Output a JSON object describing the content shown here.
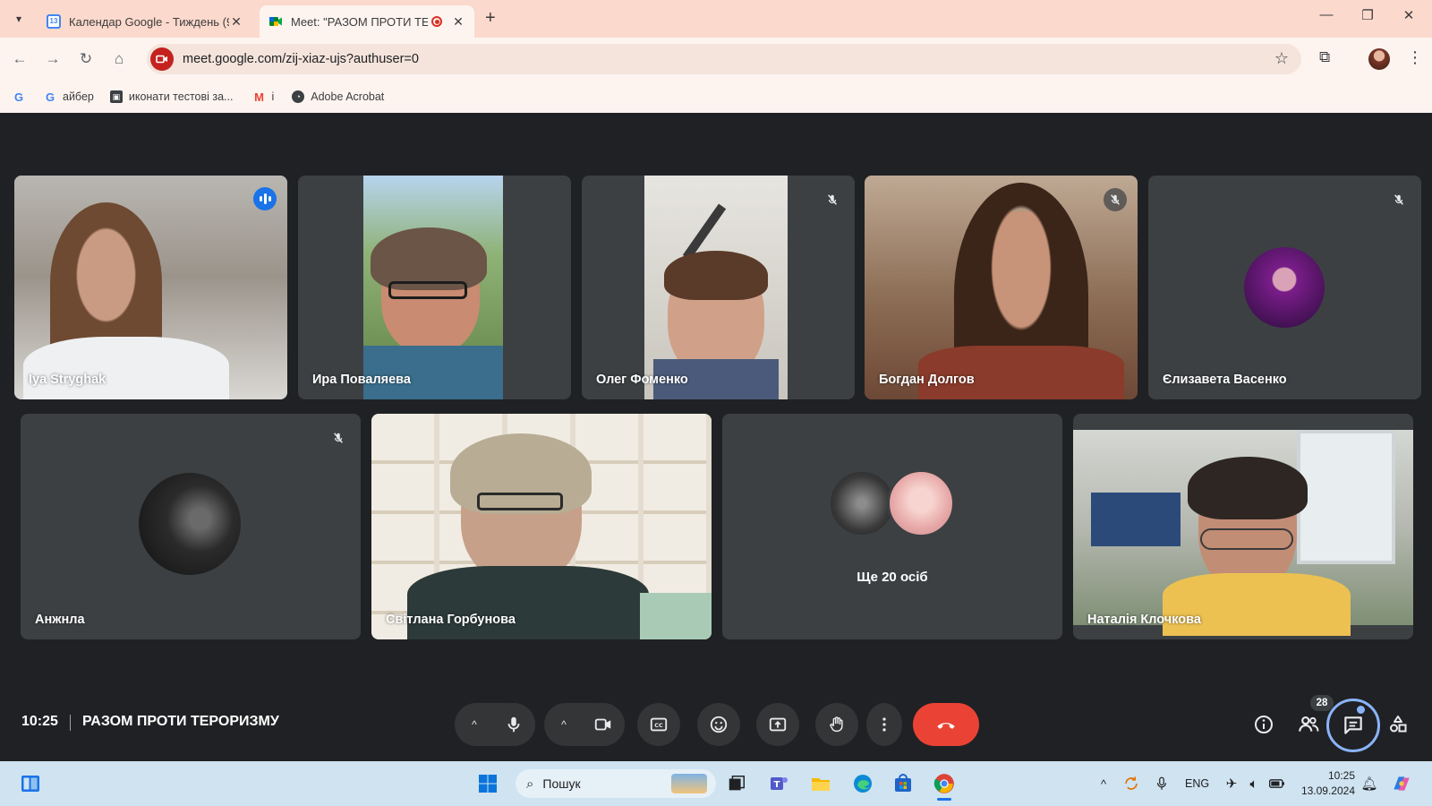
{
  "browser": {
    "tabs": [
      {
        "title": "Календар Google - Тиждень (9",
        "favicon": "calendar-icon",
        "active": false
      },
      {
        "title": "Meet: \"РАЗОМ ПРОТИ ТЕР",
        "favicon": "meet-icon",
        "active": true
      }
    ],
    "url": "meet.google.com/zij-xiaz-ujs?authuser=0",
    "bookmarks": [
      {
        "label": "",
        "icon": "google-icon"
      },
      {
        "label": "айбер",
        "icon": "google-icon"
      },
      {
        "label": "иконати тестові за...",
        "icon": "classroom-icon"
      },
      {
        "label": "і",
        "icon": "gmail-icon"
      },
      {
        "label": "Adobe Acrobat",
        "icon": "acrobat-icon"
      }
    ]
  },
  "meet": {
    "time": "10:25",
    "title": "РАЗОМ ПРОТИ ТЕРОРИЗМУ",
    "participants": [
      {
        "name": "Iya Stryghak",
        "state": "speaking"
      },
      {
        "name": "Ира Поваляева",
        "state": "video"
      },
      {
        "name": "Олег Фоменко",
        "state": "muted"
      },
      {
        "name": "Богдан Долгов",
        "state": "muted"
      },
      {
        "name": "Єлизавета Васенко",
        "state": "muted"
      },
      {
        "name": "Анжнла",
        "state": "muted"
      },
      {
        "name": "Світлана Горбунова",
        "state": "video"
      },
      {
        "name": "Наталія Клочкова",
        "state": "video"
      }
    ],
    "more_participants": "Ще 20 осіб",
    "people_count": "28",
    "colors": {
      "accent": "#8ab4f8",
      "hangup": "#ea4335",
      "tile": "#3c4043",
      "background": "#202124"
    }
  },
  "taskbar": {
    "search_placeholder": "Пошук",
    "language": "ENG",
    "time": "10:25",
    "date": "13.09.2024"
  }
}
